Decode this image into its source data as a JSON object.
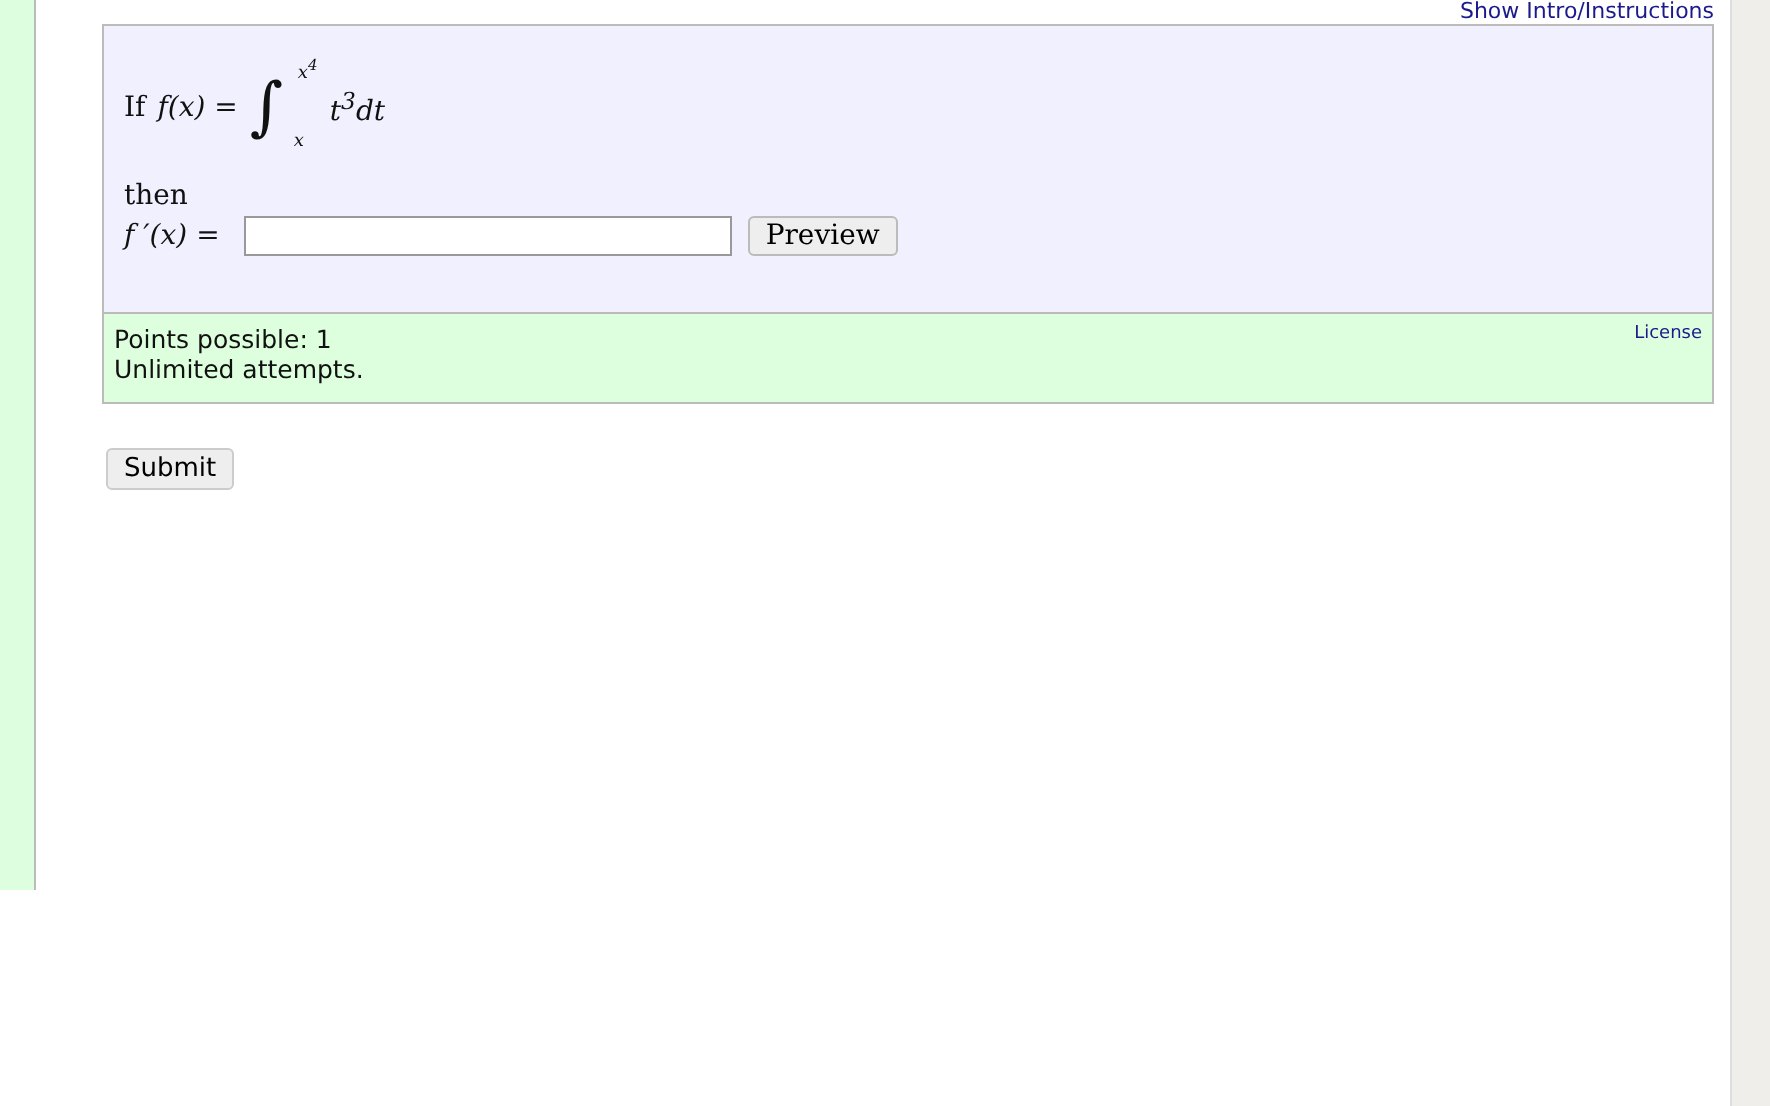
{
  "intro_link": "Show Intro/Instructions",
  "question": {
    "prefix": "If",
    "lhs": "f(x) =",
    "integral_sign": "∫",
    "upper_limit": "x$^{4}$",
    "lower_limit": "x",
    "integrand": "t$^{3}$dt",
    "then": "then",
    "answer_label": "f ′(x) =",
    "preview_button": "Preview"
  },
  "info": {
    "points": "Points possible: 1",
    "attempts": "Unlimited attempts.",
    "license_link": "License"
  },
  "submit_button": "Submit"
}
